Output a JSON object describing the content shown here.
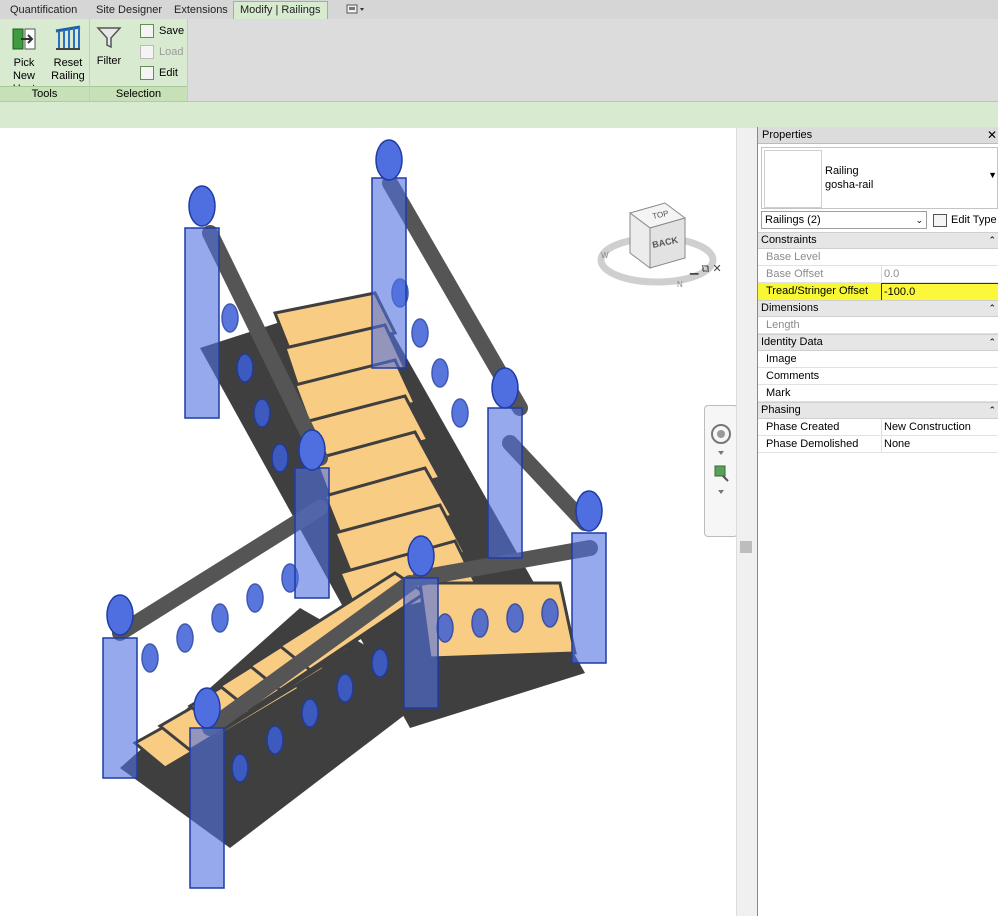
{
  "tabs": [
    {
      "label": "Quantification"
    },
    {
      "label": "Site Designer"
    },
    {
      "label": "Extensions"
    },
    {
      "label": "Modify | Railings",
      "active": true
    }
  ],
  "ribbon": {
    "tools_panel": {
      "label": "Tools",
      "pick_new_host": {
        "line1": "Pick",
        "line2": "New Host"
      },
      "reset_railing": {
        "line1": "Reset",
        "line2": "Railing"
      }
    },
    "selection_panel": {
      "label": "Selection",
      "filter": "Filter",
      "save": "Save",
      "load": "Load",
      "edit": "Edit"
    }
  },
  "viewcube": {
    "top_label": "TOP",
    "face_label": "BACK",
    "compass": [
      "W",
      "N"
    ]
  },
  "properties": {
    "title": "Properties",
    "type_family": "Railing",
    "type_name": "gosha-rail",
    "instance_selector": "Railings (2)",
    "edit_type": "Edit Type",
    "sections": [
      {
        "name": "Constraints",
        "rows": [
          {
            "label": "Base Level",
            "value": "",
            "disabled": true
          },
          {
            "label": "Base Offset",
            "value": "0.0",
            "disabled": true
          },
          {
            "label": "Tread/Stringer Offset",
            "value": "-100.0",
            "highlight": true
          }
        ]
      },
      {
        "name": "Dimensions",
        "rows": [
          {
            "label": "Length",
            "value": "",
            "disabled": true
          }
        ]
      },
      {
        "name": "Identity Data",
        "rows": [
          {
            "label": "Image",
            "value": ""
          },
          {
            "label": "Comments",
            "value": ""
          },
          {
            "label": "Mark",
            "value": ""
          }
        ]
      },
      {
        "name": "Phasing",
        "rows": [
          {
            "label": "Phase Created",
            "value": "New Construction"
          },
          {
            "label": "Phase Demolished",
            "value": "None"
          }
        ]
      }
    ]
  },
  "colors": {
    "ribbon_green": "#d8ead0",
    "tread": "#f9cc84",
    "stringer": "#3f3f3f",
    "railing_selected": "#2a4ed8",
    "highlight": "#f7f733"
  }
}
